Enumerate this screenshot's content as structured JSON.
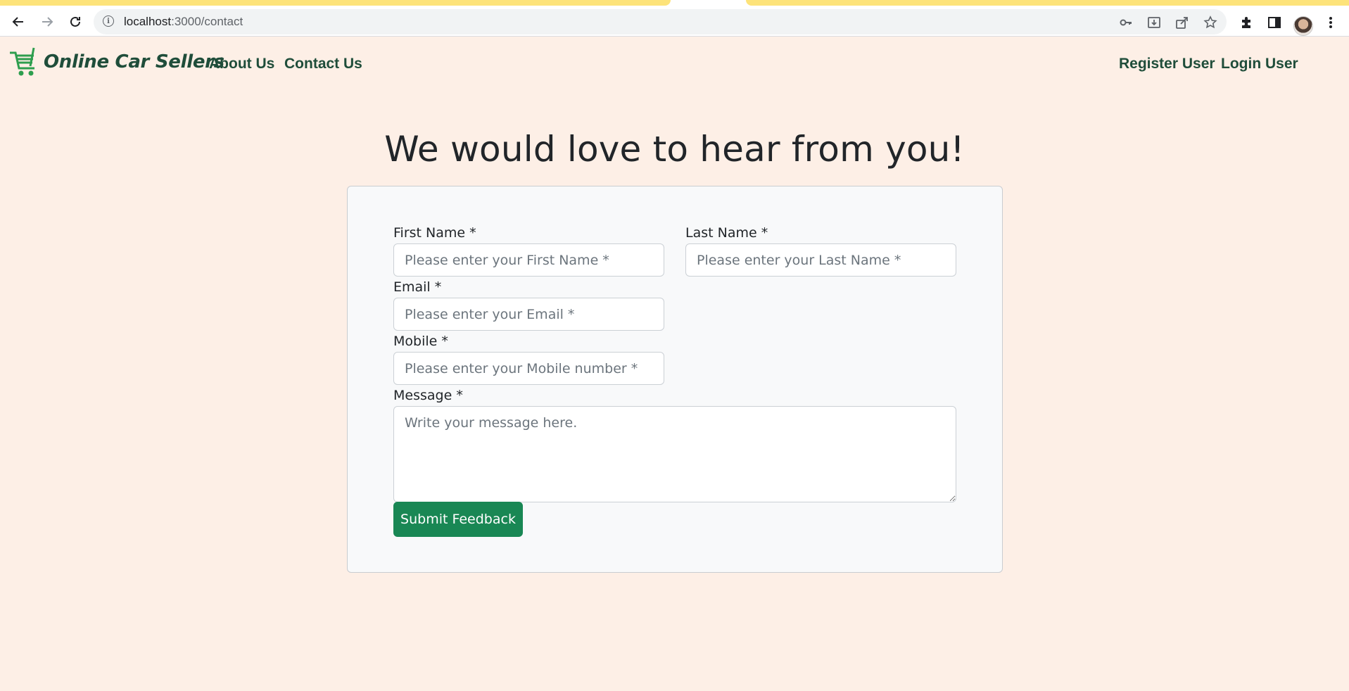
{
  "browser": {
    "url_host": "localhost",
    "url_path": ":3000/contact"
  },
  "navbar": {
    "brand": "Online Car Sellers",
    "links": [
      "About Us",
      "Contact Us"
    ],
    "right_links": [
      "Register User",
      "Login User"
    ]
  },
  "page": {
    "title": "We would love to hear from you!"
  },
  "form": {
    "first_name": {
      "label": "First Name *",
      "placeholder": "Please enter your First Name *"
    },
    "last_name": {
      "label": "Last Name *",
      "placeholder": "Please enter your Last Name *"
    },
    "email": {
      "label": "Email *",
      "placeholder": "Please enter your Email *"
    },
    "mobile": {
      "label": "Mobile *",
      "placeholder": "Please enter your Mobile number *"
    },
    "message": {
      "label": "Message *",
      "placeholder": "Write your message here."
    },
    "submit_label": "Submit Feedback"
  },
  "colors": {
    "page_background": "#fdefe6",
    "brand_text": "#1f4d3a",
    "logo_green": "#2e9e4e",
    "submit_button": "#198754",
    "tab_strip": "#fde37a"
  },
  "icons": [
    "back-arrow-icon",
    "forward-arrow-icon",
    "reload-icon",
    "info-icon",
    "key-icon",
    "install-icon",
    "share-icon",
    "bookmark-star-icon",
    "extensions-icon",
    "side-panel-icon",
    "profile-avatar",
    "menu-kebab-icon",
    "cart-logo-icon"
  ]
}
